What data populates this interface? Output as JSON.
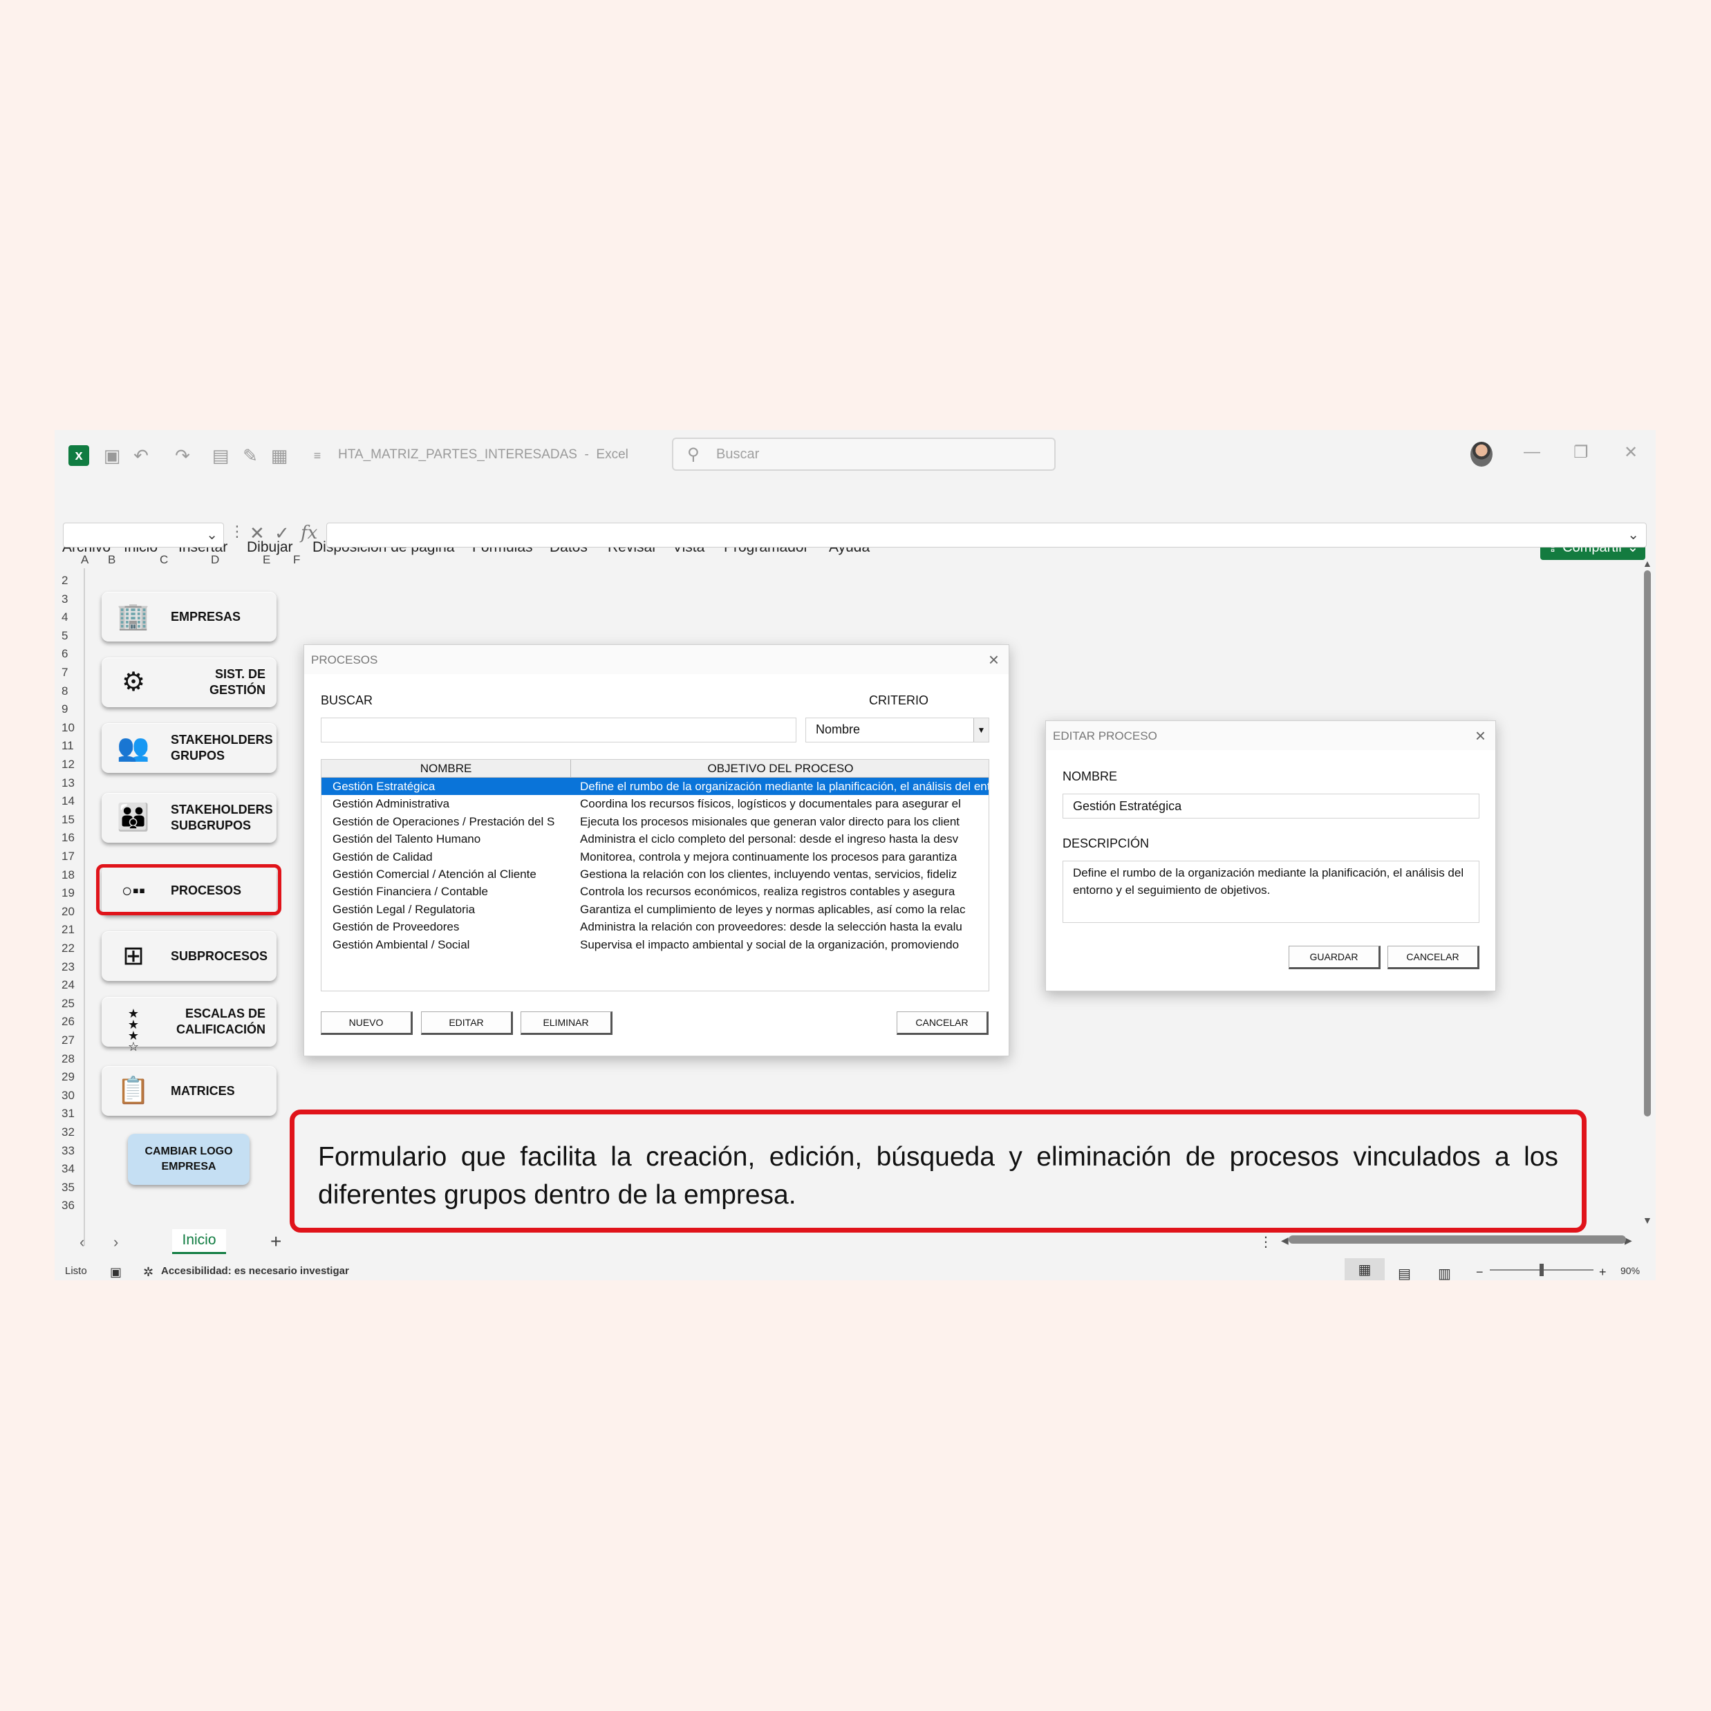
{
  "app": {
    "doc_title": "HTA_MATRIZ_PARTES_INTERESADAS",
    "app_name": "Excel",
    "search_placeholder": "Buscar",
    "share_label": "Compartir",
    "menu": [
      "Archivo",
      "Inicio",
      "Insertar",
      "Dibujar",
      "Disposición de página",
      "Fórmulas",
      "Datos",
      "Revisar",
      "Vista",
      "Programador",
      "Ayuda"
    ]
  },
  "grid": {
    "columns": [
      "A",
      "B",
      "C",
      "D",
      "E",
      "F"
    ],
    "rows": [
      "2",
      "3",
      "4",
      "5",
      "6",
      "7",
      "8",
      "9",
      "10",
      "11",
      "12",
      "13",
      "14",
      "15",
      "16",
      "17",
      "18",
      "19",
      "20",
      "21",
      "22",
      "23",
      "24",
      "25",
      "26",
      "27",
      "28",
      "29",
      "30",
      "31",
      "32",
      "33",
      "34",
      "35",
      "36"
    ]
  },
  "sidebar": {
    "empresas": "EMPRESAS",
    "sist_gestion": "SIST. DE GESTIÓN",
    "stakeholders_grupos": "STAKEHOLDERS GRUPOS",
    "stakeholders_subgrupos": "STAKEHOLDERS SUBGRUPOS",
    "procesos": "PROCESOS",
    "subprocesos": "SUBPROCESOS",
    "escalas": "ESCALAS DE CALIFICACIÓN",
    "matrices": "MATRICES",
    "cambiar_logo": "CAMBIAR LOGO EMPRESA"
  },
  "procesos_dialog": {
    "title": "PROCESOS",
    "buscar_label": "BUSCAR",
    "criterio_label": "CRITERIO",
    "criterio_value": "Nombre",
    "col_nombre": "NOMBRE",
    "col_objetivo": "OBJETIVO DEL PROCESO",
    "rows": [
      {
        "nombre": "Gestión Estratégica",
        "objetivo": "Define el rumbo de la organización mediante la planificación, el análisis del entorno y el seguimiento de objetivos."
      },
      {
        "nombre": "Gestión Administrativa",
        "objetivo": "Coordina los recursos físicos, logísticos y documentales para asegurar el"
      },
      {
        "nombre": "Gestión de Operaciones / Prestación del S",
        "objetivo": "Ejecuta los procesos misionales que generan valor directo para los client"
      },
      {
        "nombre": "Gestión del Talento Humano",
        "objetivo": "Administra el ciclo completo del personal: desde el ingreso hasta la desv"
      },
      {
        "nombre": "Gestión de Calidad",
        "objetivo": "Monitorea, controla y mejora continuamente los procesos para garantiza"
      },
      {
        "nombre": "Gestión Comercial / Atención al Cliente",
        "objetivo": "Gestiona la relación con los clientes, incluyendo ventas, servicios, fideliz"
      },
      {
        "nombre": "Gestión Financiera / Contable",
        "objetivo": "Controla los recursos económicos, realiza registros contables y asegura"
      },
      {
        "nombre": "Gestión Legal / Regulatoria",
        "objetivo": "Garantiza el cumplimiento de leyes y normas aplicables, así como la relac"
      },
      {
        "nombre": "Gestión de Proveedores",
        "objetivo": "Administra la relación con proveedores: desde la selección hasta la evalu"
      },
      {
        "nombre": "Gestión Ambiental / Social",
        "objetivo": "Supervisa el impacto ambiental y social de la organización, promoviendo"
      }
    ],
    "btn_nuevo": "NUEVO",
    "btn_editar": "EDITAR",
    "btn_eliminar": "ELIMINAR",
    "btn_cancelar": "CANCELAR"
  },
  "editar_dialog": {
    "title": "EDITAR PROCESO",
    "nombre_label": "NOMBRE",
    "nombre_value": "Gestión Estratégica",
    "descripcion_label": "DESCRIPCIÓN",
    "descripcion_value": "Define el rumbo de la organización mediante la planificación, el análisis del entorno y el seguimiento de objetivos.",
    "btn_guardar": "GUARDAR",
    "btn_cancelar": "CANCELAR"
  },
  "sheets": {
    "active": "Inicio"
  },
  "status": {
    "ready": "Listo",
    "accessibility": "Accesibilidad: es necesario investigar",
    "zoom": "90%",
    "zoom_level_fraction": 0.5
  },
  "caption": "Formulario que facilita la creación, edición, búsqueda y eliminación de procesos vinculados a los diferentes grupos dentro de la empresa."
}
